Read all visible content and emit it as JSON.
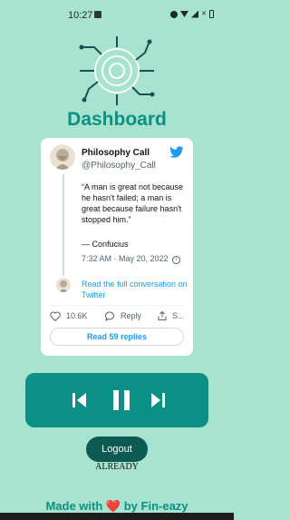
{
  "status_bar": {
    "time": "10:27",
    "icons": [
      "photo-icon",
      "alarm-icon",
      "wifi-icon",
      "signal-icon",
      "no-data-icon",
      "battery-icon"
    ]
  },
  "page": {
    "title": "Dashboard"
  },
  "tweet": {
    "name": "Philosophy Call",
    "handle": "@Philosophy_Call",
    "text": "“A man is great not because he hasn't failed; a man is great because failure hasn't stopped him.”",
    "attribution": "— Confucius",
    "timestamp": "7:32 AM · May 20, 2022",
    "conversation_link": "Read the full conversation on Twitter",
    "likes": "10.6K",
    "reply_label": "Reply",
    "share_label": "S...",
    "read_replies": "Read 59 replies",
    "brand_color": "#1d9bf0"
  },
  "player": {
    "controls": [
      "previous-icon",
      "pause-icon",
      "next-icon"
    ],
    "color": "#0c8f84"
  },
  "logout": {
    "label": "Logout",
    "note": "ALREADY"
  },
  "footer": {
    "prefix": "Made with",
    "heart": "❤️",
    "suffix": "by Fin-eazy"
  }
}
